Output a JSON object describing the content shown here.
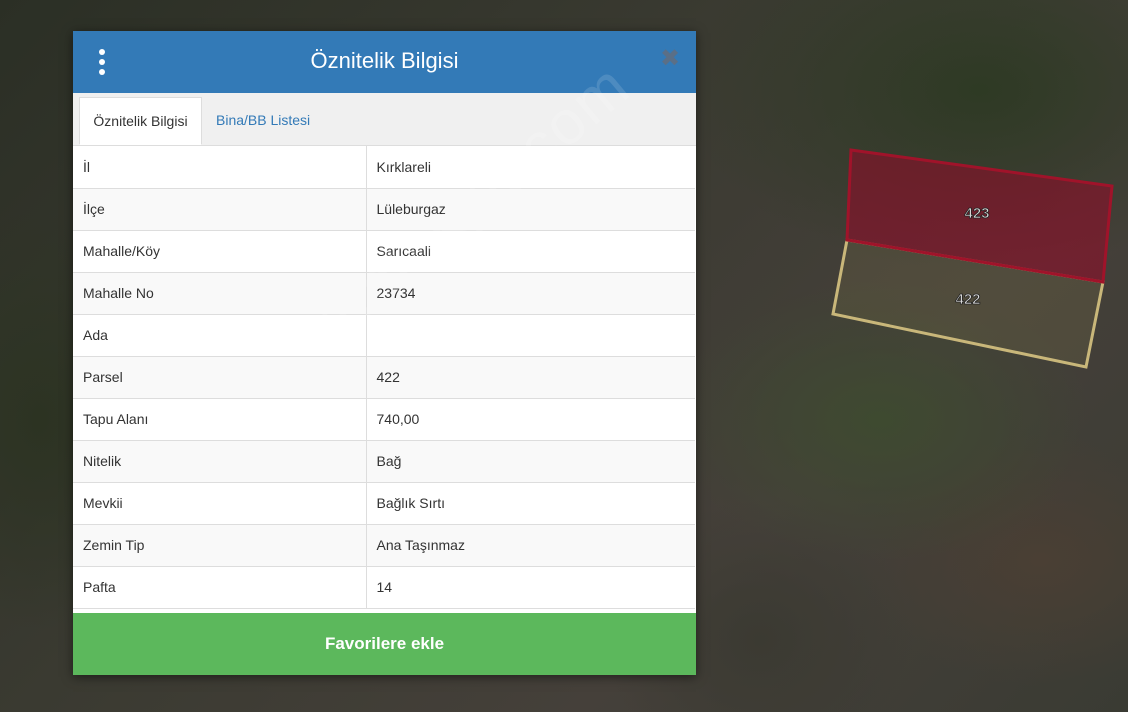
{
  "panel": {
    "title": "Öznitelik Bilgisi",
    "menu_icon": "kebab-menu-icon",
    "close_icon": "close-icon",
    "close_glyph": "✖",
    "header_color": "#337ab7"
  },
  "tabs": [
    {
      "label": "Öznitelik Bilgisi",
      "active": true
    },
    {
      "label": "Bina/BB Listesi",
      "active": false
    }
  ],
  "attributes": [
    {
      "key": "İl",
      "value": "Kırklareli"
    },
    {
      "key": "İlçe",
      "value": "Lüleburgaz"
    },
    {
      "key": "Mahalle/Köy",
      "value": "Sarıcaali"
    },
    {
      "key": "Mahalle No",
      "value": "23734"
    },
    {
      "key": "Ada",
      "value": ""
    },
    {
      "key": "Parsel",
      "value": "422"
    },
    {
      "key": "Tapu Alanı",
      "value": "740,00"
    },
    {
      "key": "Nitelik",
      "value": "Bağ"
    },
    {
      "key": "Mevkii",
      "value": "Bağlık Sırtı"
    },
    {
      "key": "Zemin Tip",
      "value": "Ana Taşınmaz"
    },
    {
      "key": "Pafta",
      "value": "14"
    }
  ],
  "favorite_button": {
    "label": "Favorilere ekle",
    "color": "#5cb85c"
  },
  "map": {
    "parcels": [
      {
        "label": "423",
        "selected": true,
        "outline_color": "#a0132a"
      },
      {
        "label": "422",
        "selected": false,
        "outline_color": "#c9b77a"
      }
    ]
  },
  "watermark": "emlakjet.com"
}
